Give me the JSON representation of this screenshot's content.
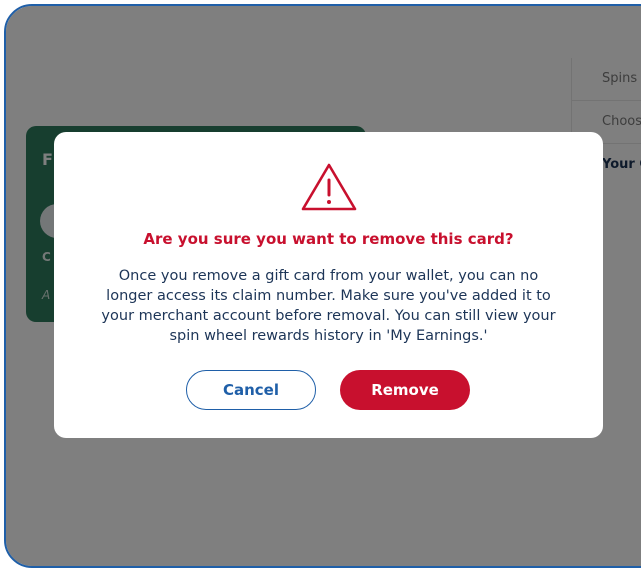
{
  "background": {
    "card": {
      "title_fragment": "F",
      "code_fragment": "C",
      "note_fragment": "A"
    },
    "sidebar": {
      "items": [
        {
          "label": "Spins"
        },
        {
          "label": "Choos"
        },
        {
          "label": "Your C"
        }
      ]
    }
  },
  "modal": {
    "icon": "warning-triangle-icon",
    "title": "Are you sure you want to remove this card?",
    "body": "Once you remove a gift card from your wallet, you can no longer access its claim number. Make sure you've added it to your merchant account before removal. You can still view your spin wheel rewards history in 'My Earnings.'",
    "cancel_label": "Cancel",
    "remove_label": "Remove"
  },
  "colors": {
    "accent_red": "#c8102e",
    "accent_blue": "#1f5fa8",
    "text_navy": "#1d3557",
    "card_green": "#2e7d5e"
  }
}
